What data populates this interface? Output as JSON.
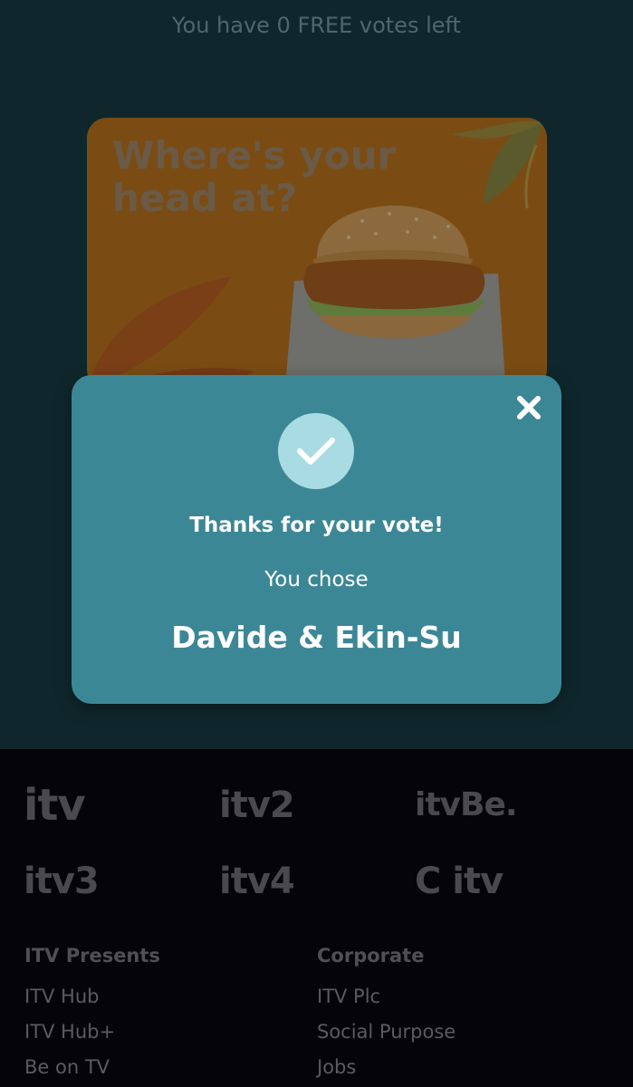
{
  "votes": {
    "text": "You have 0 FREE votes left"
  },
  "ad": {
    "headline": "Where's your head at?",
    "colors": {
      "background": "#7a4c14",
      "headline": "#6b5a46"
    }
  },
  "modal": {
    "close_icon": "close-icon",
    "check_icon": "check-icon",
    "thanks": "Thanks for your vote!",
    "you_chose": "You chose",
    "selection": "Davide & Ekin-Su",
    "colors": {
      "background": "#3c8796",
      "check_circle": "#a9dbe3"
    }
  },
  "footer": {
    "logos": [
      "itv",
      "itv2",
      "itvBe.",
      "itv3",
      "itv4",
      "C itv"
    ],
    "columns": [
      {
        "heading": "ITV Presents",
        "links": [
          "ITV Hub",
          "ITV Hub+",
          "Be on TV"
        ]
      },
      {
        "heading": "Corporate",
        "links": [
          "ITV Plc",
          "Social Purpose",
          "Jobs"
        ]
      }
    ]
  }
}
